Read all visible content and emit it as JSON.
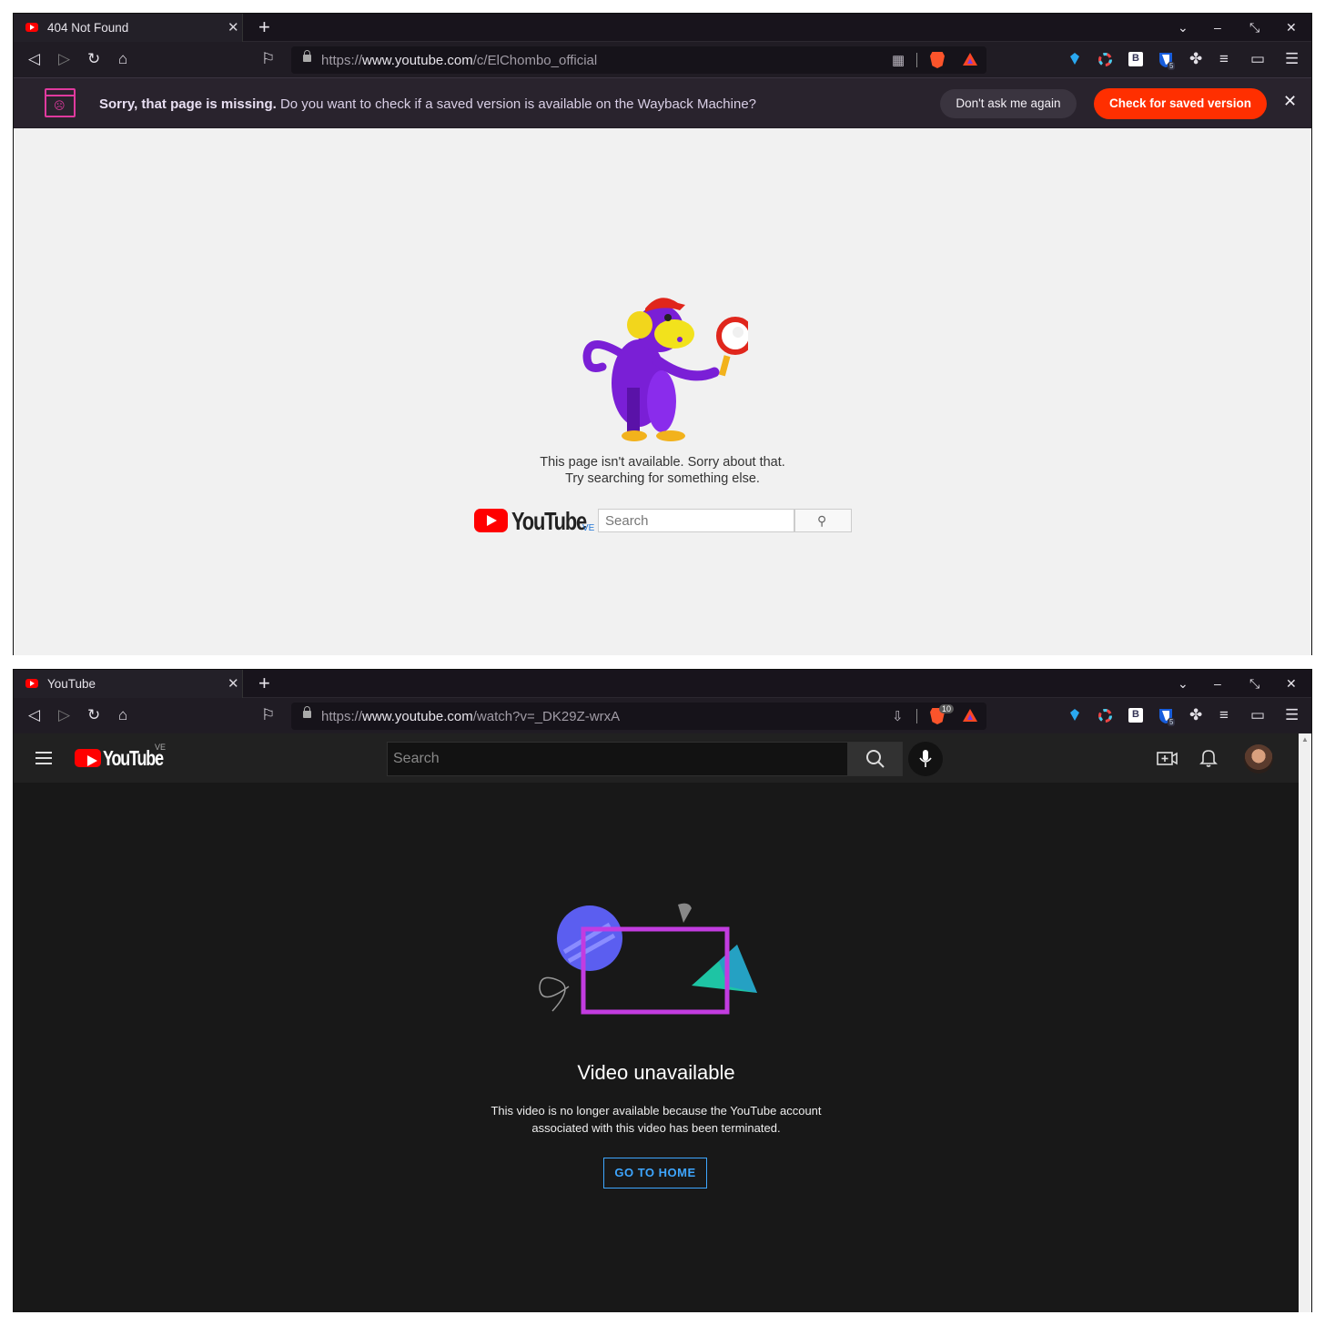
{
  "window1": {
    "tab_title": "404 Not Found",
    "url_scheme": "https://",
    "url_host": "www.youtube.com",
    "url_path": "/c/ElChombo_official",
    "infobar": {
      "bold": "Sorry, that page is missing.",
      "text": "Do you want to check if a saved version is available on the Wayback Machine?",
      "dont_ask": "Don't ask me again",
      "check": "Check for saved version"
    },
    "message_line1": "This page isn't available. Sorry about that.",
    "message_line2": "Try searching for something else.",
    "logo_text": "YouTube",
    "logo_region": "VE",
    "search_placeholder": "Search"
  },
  "window2": {
    "tab_title": "YouTube",
    "url_scheme": "https://",
    "url_host": "www.youtube.com",
    "url_path": "/watch?v=_DK29Z-wrxA",
    "shields_count": "10",
    "logo_text": "YouTube",
    "logo_region": "VE",
    "search_placeholder": "Search",
    "title": "Video unavailable",
    "desc_line1": "This video is no longer available because the YouTube account",
    "desc_line2": "associated with this video has been terminated.",
    "go_home": "GO TO HOME"
  },
  "extensions_badge": "5",
  "colors": {
    "brave_orange": "#ff2f00",
    "yt_red": "#ff0000",
    "link_blue": "#3ea6ff"
  }
}
